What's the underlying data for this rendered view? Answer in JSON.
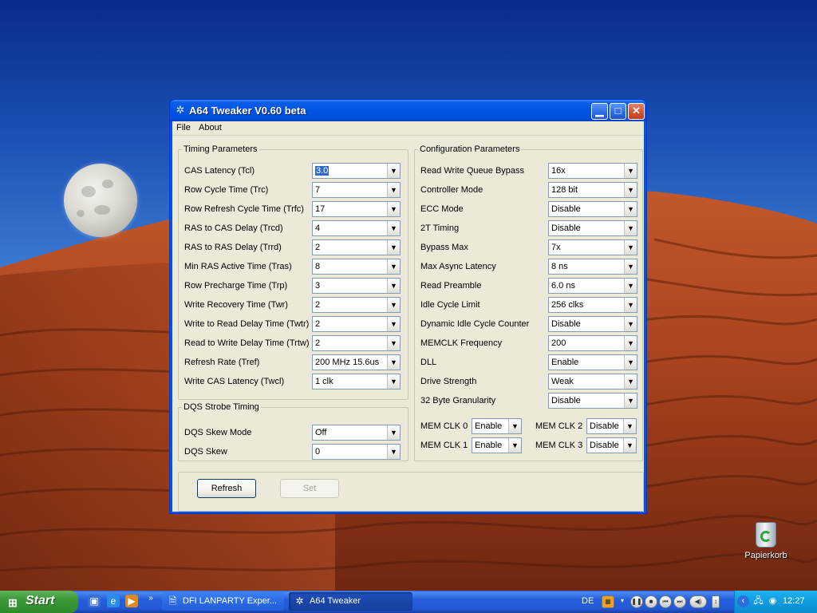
{
  "desktop": {
    "recycle_bin_label": "Papierkorb"
  },
  "window": {
    "title": "A64 Tweaker V0.60 beta",
    "menu": [
      "File",
      "About"
    ],
    "timing": {
      "legend": "Timing Parameters",
      "rows": [
        {
          "label": "CAS Latency (Tcl)",
          "value": "3.0"
        },
        {
          "label": "Row Cycle Time (Trc)",
          "value": "7"
        },
        {
          "label": "Row Refresh Cycle Time (Trfc)",
          "value": "17"
        },
        {
          "label": "RAS to CAS Delay (Trcd)",
          "value": "4"
        },
        {
          "label": "RAS to RAS Delay (Trrd)",
          "value": "2"
        },
        {
          "label": "Min RAS Active Time (Tras)",
          "value": "8"
        },
        {
          "label": "Row Precharge Time (Trp)",
          "value": "3"
        },
        {
          "label": "Write Recovery Time (Twr)",
          "value": "2"
        },
        {
          "label": "Write to Read Delay Time (Twtr)",
          "value": "2"
        },
        {
          "label": "Read to Write Delay Time (Trtw)",
          "value": "2"
        },
        {
          "label": "Refresh Rate (Tref)",
          "value": "200 MHz 15.6us"
        },
        {
          "label": "Write CAS Latency (Twcl)",
          "value": "1 clk"
        }
      ]
    },
    "dqs": {
      "legend": "DQS Strobe Timing",
      "rows": [
        {
          "label": "DQS Skew Mode",
          "value": "Off"
        },
        {
          "label": "DQS Skew",
          "value": "0"
        }
      ]
    },
    "config": {
      "legend": "Configuration Parameters",
      "rows": [
        {
          "label": "Read Write Queue Bypass",
          "value": "16x"
        },
        {
          "label": "Controller Mode",
          "value": "128 bit"
        },
        {
          "label": "ECC Mode",
          "value": "Disable"
        },
        {
          "label": "2T Timing",
          "value": "Disable"
        },
        {
          "label": "Bypass Max",
          "value": "7x"
        },
        {
          "label": "Max Async Latency",
          "value": "8 ns"
        },
        {
          "label": "Read Preamble",
          "value": "6.0 ns"
        },
        {
          "label": "Idle Cycle Limit",
          "value": "256 clks"
        },
        {
          "label": "Dynamic Idle Cycle Counter",
          "value": "Disable"
        },
        {
          "label": "MEMCLK Frequency",
          "value": "200"
        },
        {
          "label": "DLL",
          "value": "Enable"
        },
        {
          "label": "Drive Strength",
          "value": "Weak"
        },
        {
          "label": "32 Byte Granularity",
          "value": "Disable"
        }
      ],
      "memclk": [
        {
          "label": "MEM CLK 0",
          "value": "Enable"
        },
        {
          "label": "MEM CLK 2",
          "value": "Disable"
        },
        {
          "label": "MEM CLK 1",
          "value": "Enable"
        },
        {
          "label": "MEM CLK 3",
          "value": "Disable"
        }
      ]
    },
    "buttons": {
      "refresh": "Refresh",
      "set": "Set"
    }
  },
  "taskbar": {
    "start_label": "Start",
    "tasks": [
      {
        "label": "DFI LANPARTY Exper..."
      },
      {
        "label": "A64 Tweaker"
      }
    ],
    "language": "DE",
    "clock": "12:27"
  }
}
